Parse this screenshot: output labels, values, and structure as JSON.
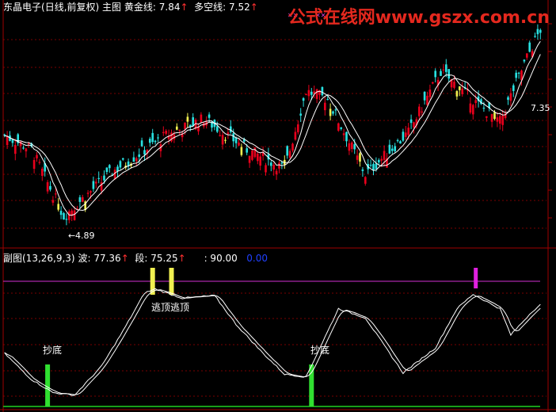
{
  "top_header": {
    "stock_name": "东晶电子",
    "period": "(日线,前复权)",
    "main_label": "主图",
    "gold_label": "黄金线:",
    "gold_value": "7.84",
    "multi_label": "多空线:",
    "multi_value": "7.52",
    "arrow": "↑"
  },
  "watermark": "公式在线网www.gszx.com.cn",
  "sub_header": {
    "name": "副图(13,26,9,3)",
    "wave_label": "波:",
    "wave_value": "77.36",
    "seg_label": "段:",
    "seg_value": "75.25",
    "level_value": ": 90.00",
    "zero_value": "0.00",
    "arrow": "↑"
  },
  "annotations": {
    "low_price": "4.89",
    "right_price": "7.35",
    "escape_top_1": "逃顶",
    "escape_top_2": "逃顶",
    "bottom_1": "抄底",
    "bottom_2": "抄底",
    "marker_glyph": "✕✕"
  },
  "colors": {
    "up": "#e8001c",
    "down": "#28e0e0",
    "yellow": "#f0f050",
    "wave": "#ffffff",
    "level_line": "#d030d0",
    "zero_line": "#20d020",
    "bottom_signal": "#30e030",
    "top_signal": "#f0f050",
    "magenta_signal": "#e020e0",
    "grid": "#7a0000",
    "header_text": "#ffffff",
    "header_red": "#ff3030",
    "zero_text": "#2040ff"
  },
  "chart_data": [
    {
      "type": "candlestick",
      "price_range": [
        4.5,
        8.6
      ],
      "key_points": [
        {
          "index": 0,
          "price": 6.45
        },
        {
          "index": 10,
          "price": 6.2
        },
        {
          "index": 22,
          "price": 5.0
        },
        {
          "index": 40,
          "price": 5.8
        },
        {
          "index": 60,
          "price": 6.45
        },
        {
          "index": 74,
          "price": 6.75
        },
        {
          "index": 90,
          "price": 6.2
        },
        {
          "index": 104,
          "price": 5.85
        },
        {
          "index": 112,
          "price": 7.25
        },
        {
          "index": 120,
          "price": 7.1
        },
        {
          "index": 134,
          "price": 5.75
        },
        {
          "index": 150,
          "price": 6.5
        },
        {
          "index": 162,
          "price": 7.6
        },
        {
          "index": 176,
          "price": 7.0
        },
        {
          "index": 184,
          "price": 6.7
        },
        {
          "index": 194,
          "price": 7.85
        },
        {
          "index": 199,
          "price": 8.35
        }
      ],
      "labeled_low": 4.89,
      "labeled_right": 7.35
    },
    {
      "type": "line",
      "y_range": [
        -5,
        105
      ],
      "levels": [
        90,
        0
      ],
      "wave": [
        {
          "index": 0,
          "value": 38
        },
        {
          "index": 10,
          "value": 18
        },
        {
          "index": 18,
          "value": 8
        },
        {
          "index": 26,
          "value": 6
        },
        {
          "index": 36,
          "value": 28
        },
        {
          "index": 44,
          "value": 55
        },
        {
          "index": 52,
          "value": 84
        },
        {
          "index": 56,
          "value": 87
        },
        {
          "index": 66,
          "value": 80
        },
        {
          "index": 78,
          "value": 82
        },
        {
          "index": 86,
          "value": 60
        },
        {
          "index": 96,
          "value": 38
        },
        {
          "index": 104,
          "value": 22
        },
        {
          "index": 112,
          "value": 20
        },
        {
          "index": 124,
          "value": 72
        },
        {
          "index": 134,
          "value": 65
        },
        {
          "index": 148,
          "value": 23
        },
        {
          "index": 160,
          "value": 42
        },
        {
          "index": 168,
          "value": 72
        },
        {
          "index": 174,
          "value": 83
        },
        {
          "index": 184,
          "value": 72
        },
        {
          "index": 188,
          "value": 52
        },
        {
          "index": 196,
          "value": 70
        },
        {
          "index": 199,
          "value": 75
        }
      ],
      "signals": [
        {
          "kind": "bottom",
          "index": 16,
          "label": "抄底"
        },
        {
          "kind": "top",
          "index": 55,
          "label": "逃顶"
        },
        {
          "kind": "top",
          "index": 62,
          "label": "逃顶"
        },
        {
          "kind": "bottom",
          "index": 114,
          "label": "抄底"
        },
        {
          "kind": "magenta",
          "index": 175
        }
      ]
    }
  ]
}
